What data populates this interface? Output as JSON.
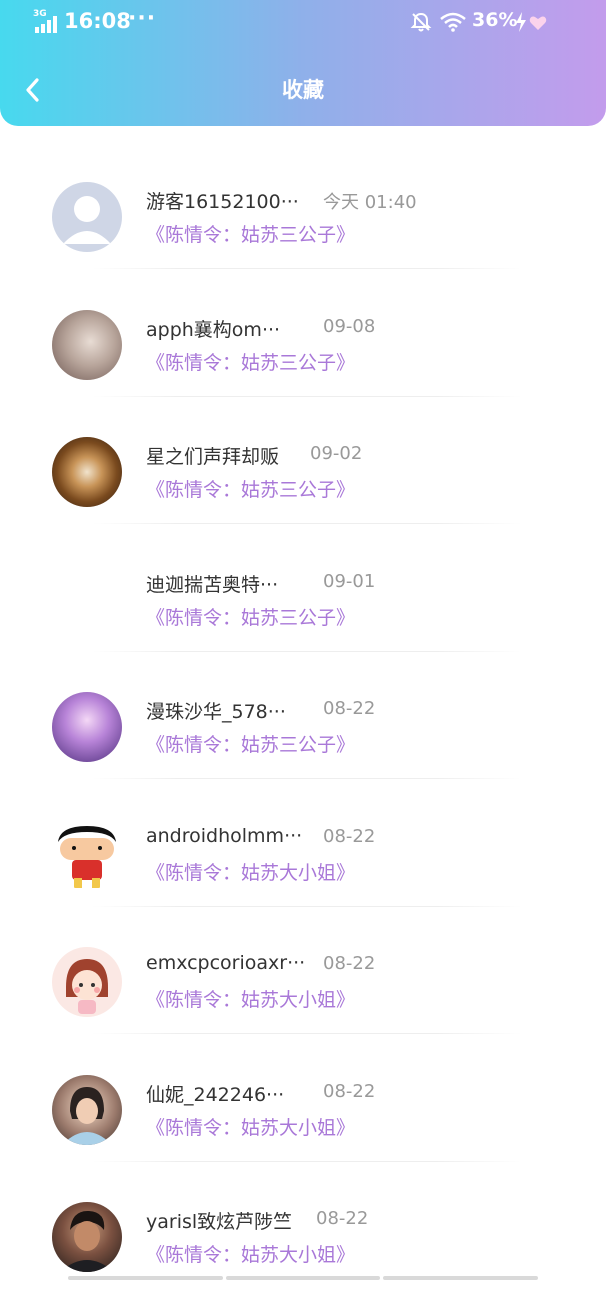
{
  "status_bar": {
    "network": "3G",
    "time": "16:08",
    "more": "···",
    "battery": "36%",
    "icons": [
      "signal-icon",
      "bell-off-icon",
      "wifi-icon",
      "bolt-icon",
      "heart-icon"
    ]
  },
  "header": {
    "title": "收藏",
    "back_icon": "chevron-left-icon"
  },
  "colors": {
    "gradient_start": "#47d9ee",
    "gradient_end": "#c39cec",
    "work_title": "#a978d8",
    "username": "#333333",
    "date": "#999999"
  },
  "items": [
    {
      "username": "游客16152100···",
      "date": "今天 01:40",
      "work": "《陈情令：姑苏三公子》",
      "avatar": "default-avatar"
    },
    {
      "username": "apph襄构om···",
      "date": "09-08",
      "work": "《陈情令：姑苏三公子》",
      "avatar": "photo-avatar"
    },
    {
      "username": "星之们声拜却贩",
      "date": "09-02",
      "work": "《陈情令：姑苏三公子》",
      "avatar": "coffee-avatar"
    },
    {
      "username": "迪迦揣苫奥特···",
      "date": "09-01",
      "work": "《陈情令：姑苏三公子》",
      "avatar": "none"
    },
    {
      "username": "漫珠沙华_578···",
      "date": "08-22",
      "work": "《陈情令：姑苏三公子》",
      "avatar": "purple-avatar"
    },
    {
      "username": "androidholmm···",
      "date": "08-22",
      "work": "《陈情令：姑苏大小姐》",
      "avatar": "cartoon-avatar"
    },
    {
      "username": "emxcpcorioaxr···",
      "date": "08-22",
      "work": "《陈情令：姑苏大小姐》",
      "avatar": "girl-avatar"
    },
    {
      "username": "仙妮_242246···",
      "date": "08-22",
      "work": "《陈情令：姑苏大小姐》",
      "avatar": "woman-avatar"
    },
    {
      "username": "yarisl致炫芦陟竺",
      "date": "08-22",
      "work": "《陈情令：姑苏大小姐》",
      "avatar": "man-avatar"
    }
  ]
}
